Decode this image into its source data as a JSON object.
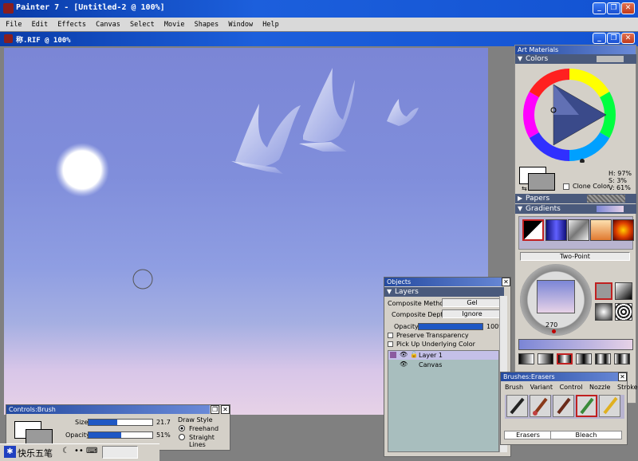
{
  "app": {
    "title": "Painter 7 - [Untitled-2 @ 100%]"
  },
  "menu": [
    "File",
    "Edit",
    "Effects",
    "Canvas",
    "Select",
    "Movie",
    "Shapes",
    "Window",
    "Help"
  ],
  "document": {
    "title": "称.RIF @ 100%"
  },
  "art_materials": {
    "title": "Art Materials",
    "colors_label": "Colors",
    "clone_color_label": "Clone Color",
    "hsv": {
      "h": "H: 97%",
      "s": "S:  3%",
      "v": "V: 61%"
    },
    "papers_label": "Papers",
    "gradients_label": "Gradients",
    "gradient_type": "Two-Point",
    "angle": "270"
  },
  "objects": {
    "title": "Objects",
    "layers_label": "Layers",
    "composite_method_label": "Composite Method",
    "composite_method_value": "Gel",
    "composite_depth_label": "Composite Depth",
    "composite_depth_value": "Ignore",
    "opacity_label": "Opacity",
    "opacity_value": "100%",
    "opacity_fraction": 1.0,
    "preserve_transparency": "Preserve Transparency",
    "pick_up_color": "Pick Up Underlying Color",
    "layers": [
      "Layer 1",
      "Canvas"
    ]
  },
  "brushes": {
    "title": "Brushes:Erasers",
    "tabs": [
      "Brush",
      "Variant",
      "Control",
      "Nozzle",
      "Stroke"
    ],
    "category": "Erasers",
    "variant": "Bleach"
  },
  "controls": {
    "title": "Controls:Brush",
    "size_label": "Size",
    "size_value": "21.7",
    "size_fraction": 0.45,
    "opacity_label": "Opacity",
    "opacity_value": "51%",
    "opacity_fraction": 0.51,
    "draw_style_label": "Draw Style",
    "freehand": "Freehand",
    "straight_lines": "Straight Lines"
  },
  "ime": {
    "label": "快乐五笔"
  },
  "colors": {
    "accent": "#1c5fdc",
    "canvas_top": "#7a87d6",
    "canvas_bottom": "#e5cfe6"
  }
}
